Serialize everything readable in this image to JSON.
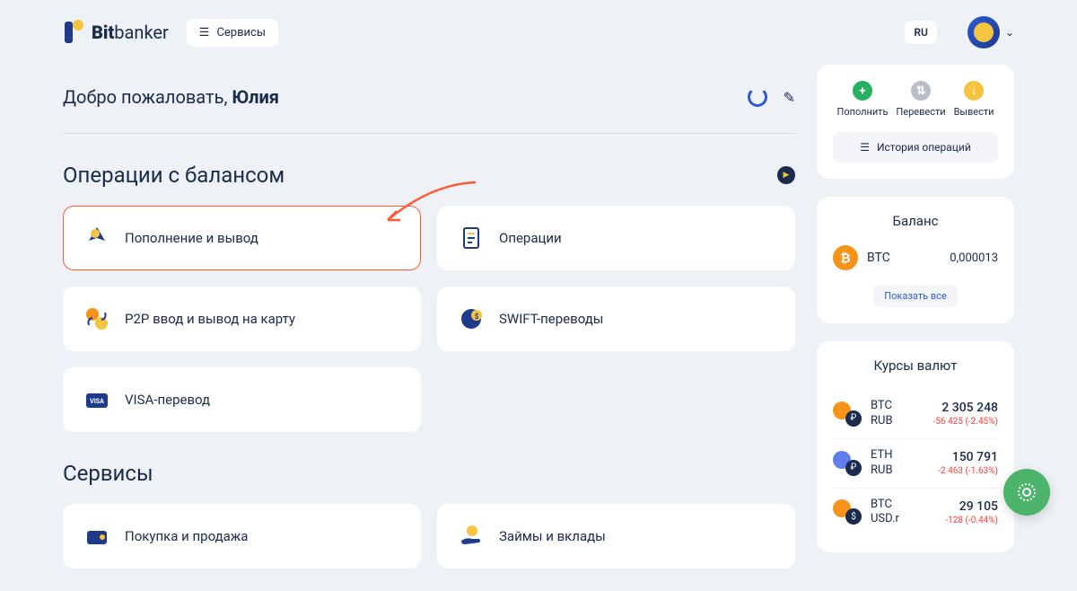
{
  "header": {
    "logo_bold": "Bit",
    "logo_thin": "banker",
    "services_btn": "Сервисы",
    "lang": "RU"
  },
  "welcome": {
    "prefix": "Добро пожаловать, ",
    "name": "Юлия"
  },
  "sections": {
    "balance_ops_title": "Операции с балансом",
    "services_title": "Сервисы"
  },
  "cards": {
    "deposit_withdraw": "Пополнение и вывод",
    "operations": "Операции",
    "p2p": "P2P ввод и вывод на карту",
    "swift": "SWIFT-переводы",
    "visa": "VISA-перевод",
    "buy_sell": "Покупка и продажа",
    "loans": "Займы и вклады"
  },
  "quick": {
    "deposit": "Пополнить",
    "transfer": "Перевести",
    "withdraw": "Вывести",
    "history": "История операций"
  },
  "balance": {
    "title": "Баланс",
    "symbol": "BTC",
    "value": "0,000013",
    "show_all": "Показать все"
  },
  "rates": {
    "title": "Курсы валют",
    "rows": [
      {
        "base": "BTC",
        "quote": "RUB",
        "price": "2 305 248",
        "change": "-56 425 (-2.45%)"
      },
      {
        "base": "ETH",
        "quote": "RUB",
        "price": "150 791",
        "change": "-2 463 (-1.63%)"
      },
      {
        "base": "BTC",
        "quote": "USD.r",
        "price": "29 105",
        "change": "-128 (-0.44%)"
      }
    ]
  },
  "colors": {
    "btc": "#f7931a",
    "eth": "#627eea",
    "usd": "#f5c542",
    "green": "#26b05f",
    "grey": "#b9bec7",
    "yellow": "#f5c542"
  }
}
